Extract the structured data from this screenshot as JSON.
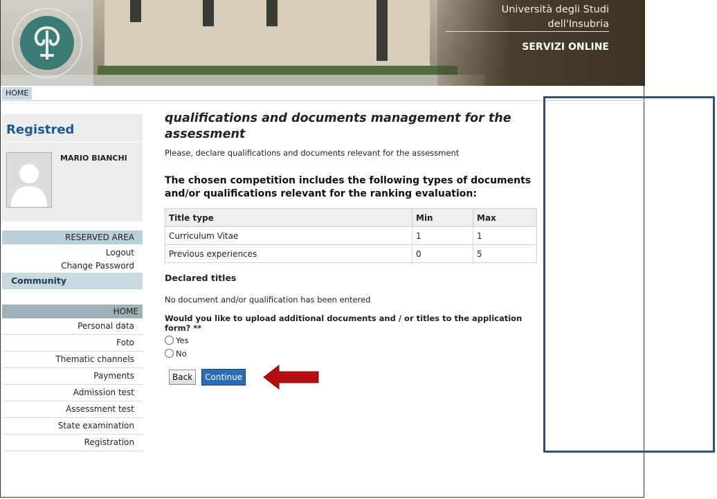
{
  "header": {
    "university_line1": "Università degli Studi",
    "university_line2": "dell'Insubria",
    "services": "SERVIZI ONLINE",
    "home_tab": "HOME"
  },
  "sidebar": {
    "heading": "Registred",
    "user_name": "MARIO BIANCHI",
    "reserved_area": "RESERVED AREA",
    "logout": "Logout",
    "change_password": "Change Password",
    "community": "Community",
    "home_section": "HOME",
    "menu": [
      "Personal data",
      "Foto",
      "Thematic channels",
      "Payments",
      "Admission test",
      "Assessment test",
      "State examination",
      "Registration"
    ]
  },
  "main": {
    "title": "qualifications and documents management for the assessment",
    "subtitle": "Please, declare qualifications and documents relevant for the assessment",
    "competition_heading": "The chosen competition includes the following types of documents and/or qualifications relevant for the ranking evaluation:",
    "table": {
      "headers": [
        "Title type",
        "Min",
        "Max"
      ],
      "rows": [
        [
          "Curriculum Vitae",
          "1",
          "1"
        ],
        [
          "Previous experiences",
          "0",
          "5"
        ]
      ]
    },
    "declared_titles": "Declared titles",
    "no_document": "No document and/or qualification has been entered",
    "question": "Would you like to upload additional documents and / or titles to the application form? **",
    "options": [
      "Yes",
      "No"
    ],
    "back_label": "Back",
    "continue_label": "Continue"
  },
  "colors": {
    "accent_arrow": "#b40f12",
    "annotation_box": "#2f4f7f",
    "continue_button": "#2a6cb6"
  }
}
